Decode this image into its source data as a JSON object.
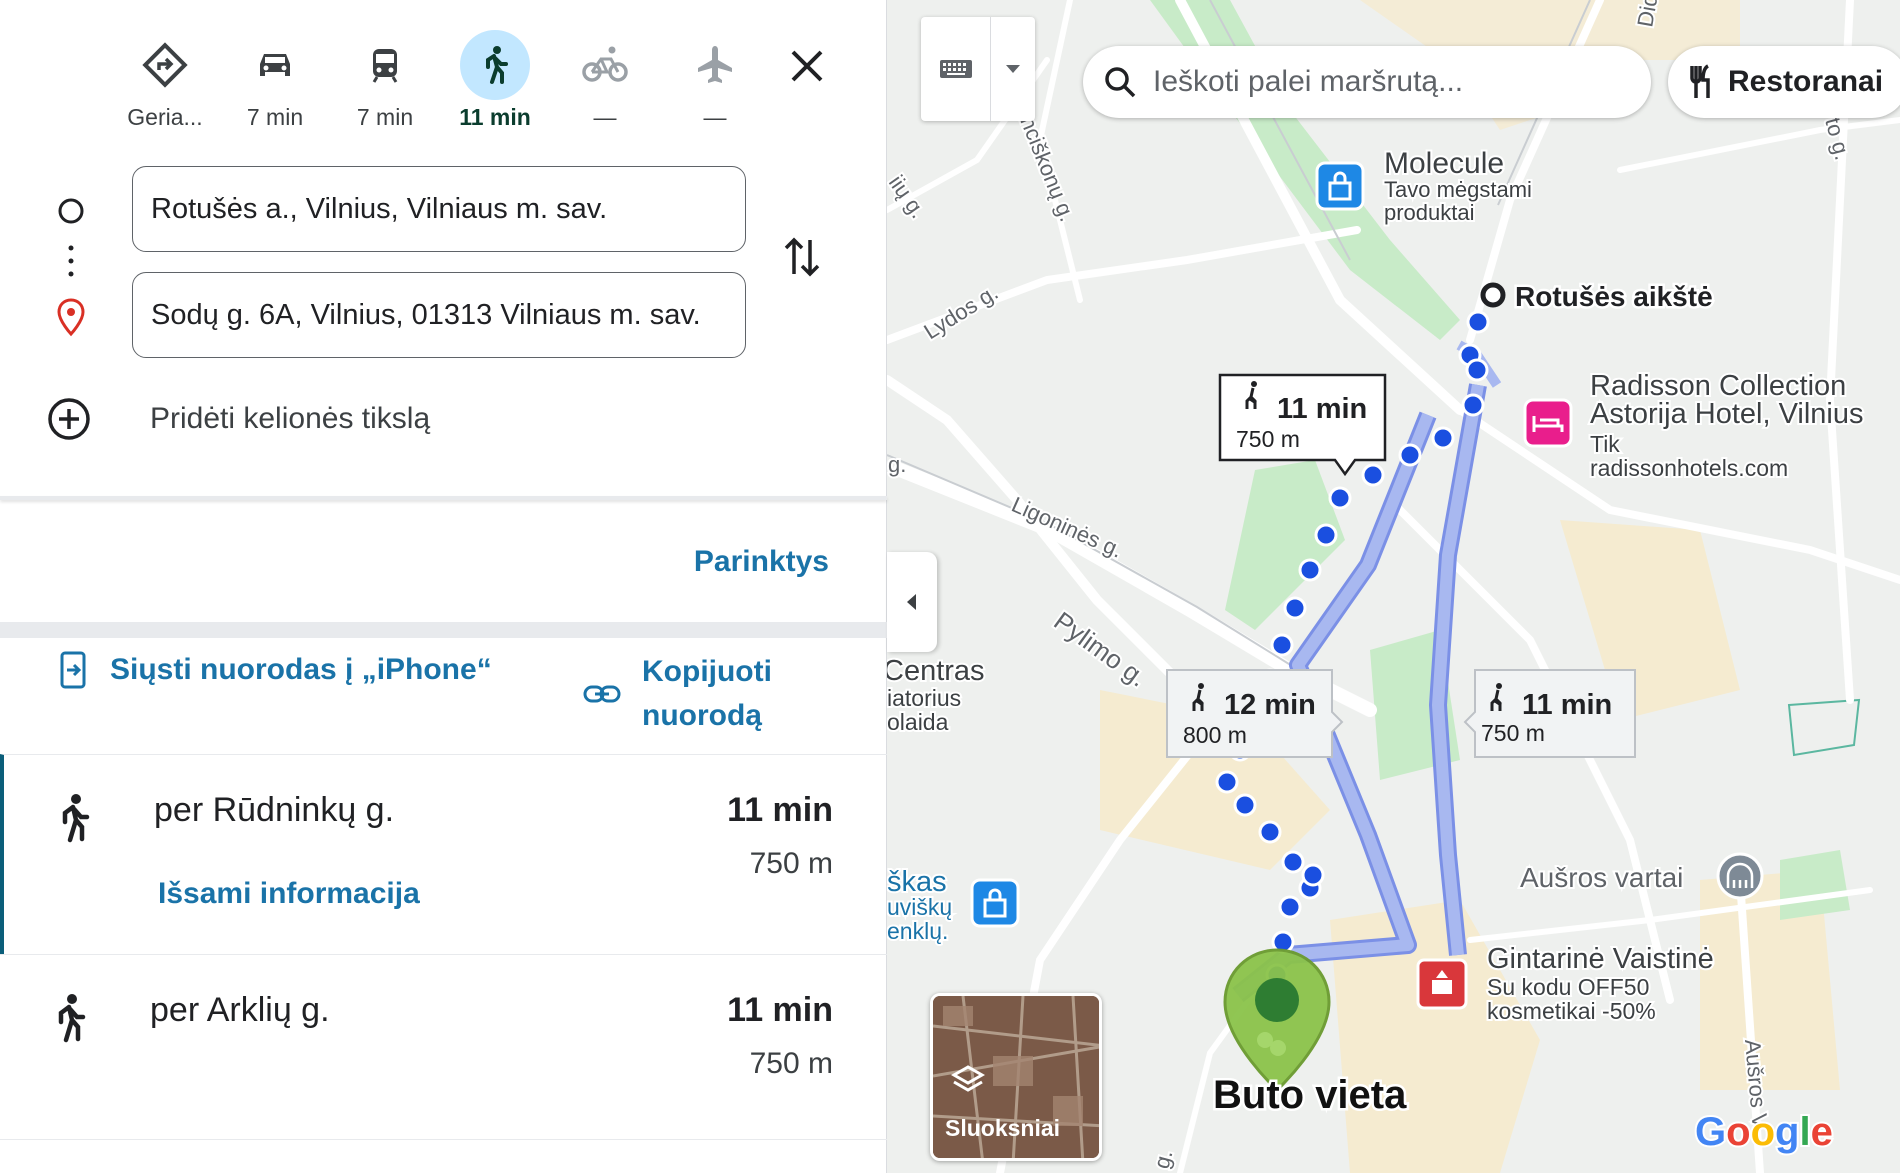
{
  "travel_modes": [
    {
      "label": "Geria...",
      "icon": "best-route-icon",
      "active": false
    },
    {
      "label": "7 min",
      "icon": "car-icon",
      "active": false
    },
    {
      "label": "7 min",
      "icon": "transit-icon",
      "active": false
    },
    {
      "label": "11 min",
      "icon": "walk-icon",
      "active": true
    },
    {
      "label": "—",
      "icon": "bicycle-icon",
      "active": false
    },
    {
      "label": "—",
      "icon": "flight-icon",
      "active": false
    }
  ],
  "origin": {
    "value": "Rotušės a., Vilnius, Vilniaus m. sav."
  },
  "destination": {
    "value": "Sodų g. 6A, Vilnius, 01313 Vilniaus m. sav."
  },
  "add_destination_label": "Pridėti kelionės tikslą",
  "options_label": "Parinktys",
  "share": {
    "send_label": "Siųsti nuorodas į „iPhone“",
    "copy_label_line1": "Kopijuoti",
    "copy_label_line2": "nuorodą"
  },
  "routes": [
    {
      "name": "per Rūdninkų g.",
      "time": "11 min",
      "distance": "750 m",
      "details_label": "Išsami informacija",
      "selected": true
    },
    {
      "name": "per Arklių g.",
      "time": "11 min",
      "distance": "750 m",
      "selected": false
    }
  ],
  "map": {
    "search_placeholder": "Ieškoti palei maršrutą...",
    "restaurants_chip": "Restoranai",
    "layers_label": "Sluoksniai",
    "origin_label": "Rotušės aikštė",
    "destination_label": "Buto vieta",
    "route_callouts": [
      {
        "time": "11 min",
        "distance": "750 m"
      },
      {
        "time": "12 min",
        "distance": "800 m"
      },
      {
        "time": "11 min",
        "distance": "750 m"
      }
    ],
    "pois": {
      "molecule": {
        "name": "Molecule",
        "line1": "Tavo mėgstami",
        "line2": "produktai"
      },
      "radisson": {
        "name1": "Radisson Collection",
        "name2": "Astorija Hotel, Vilnius",
        "line1": "Tik",
        "line2": "radissonhotels.com"
      },
      "ausros_vartai": "Aušros vartai",
      "gintarine": {
        "name": "Gintarinė Vaistinė",
        "line1": "Su kodu OFF50",
        "line2": "kosmetikai -50%"
      },
      "centras": {
        "line1": "Centras",
        "line2": "iatorius",
        "line3": "olaida"
      },
      "skas": {
        "line1": "škas",
        "line2": "uviškų",
        "line3": "enklų."
      }
    },
    "streets": {
      "lydos": "Lydos g.",
      "ligonines": "Ligoninės g.",
      "pylimo": "Pylimo g.",
      "pranciskonu": "nciškonų g.",
      "vokieciu": "iių g.",
      "ausros_vartu": "Aušros V",
      "didzioji": "Did",
      "g_left": "g.",
      "g_bottom": "g.",
      "g_right": "to g."
    },
    "logo": "Google",
    "colors": {
      "route_primary": "#1a4fe0",
      "route_alt": "#a8b8f0",
      "park": "#c8ebc8"
    }
  }
}
